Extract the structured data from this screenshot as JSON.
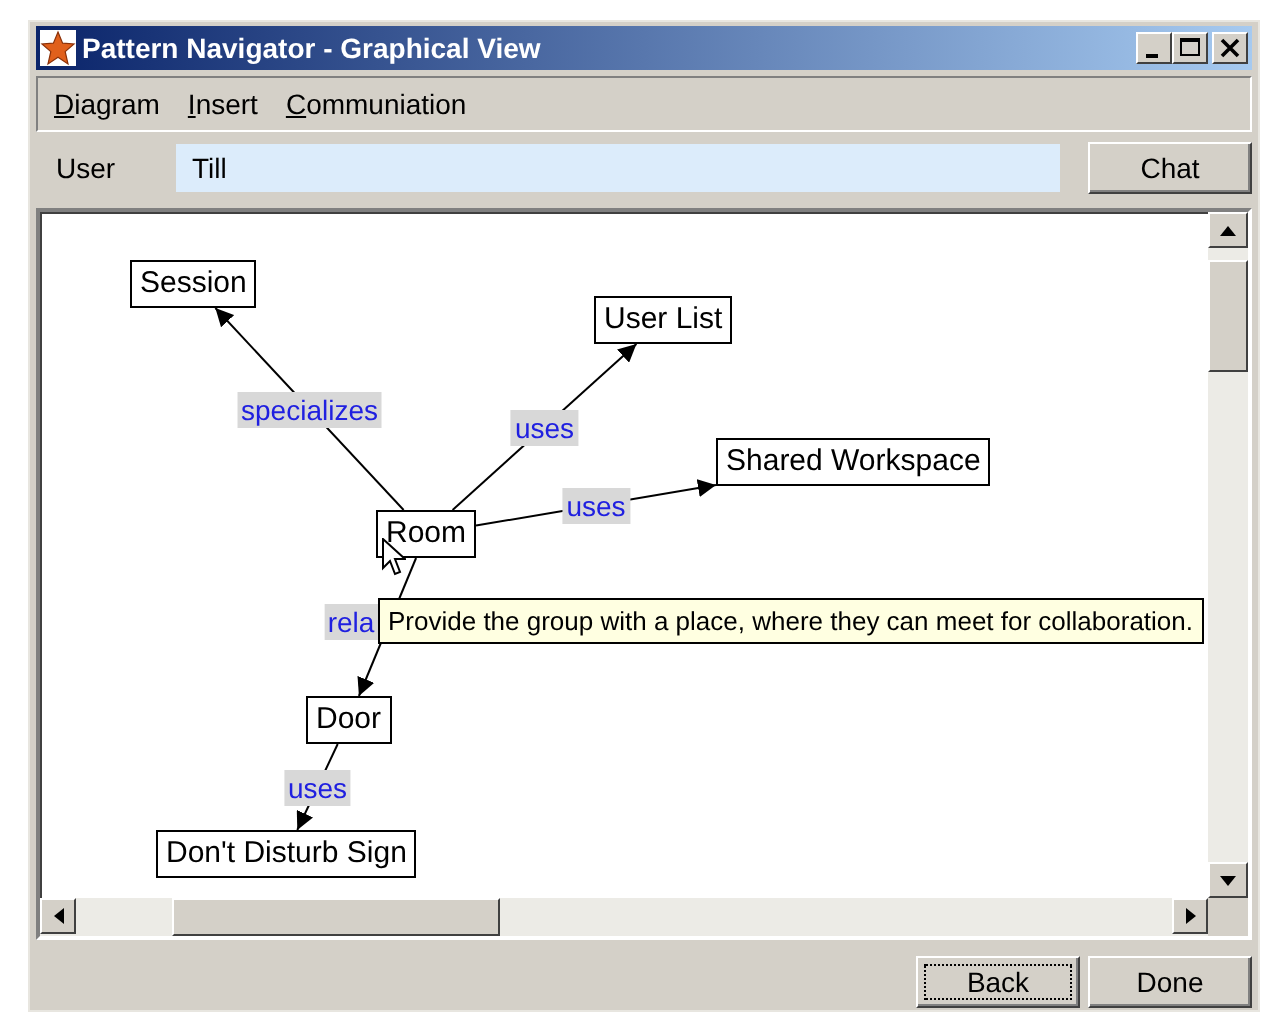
{
  "window": {
    "title": "Pattern Navigator - Graphical View"
  },
  "menu": [
    {
      "label": "Diagram"
    },
    {
      "label": "Insert"
    },
    {
      "label": "Communiation"
    }
  ],
  "user": {
    "label": "User",
    "value": "Till"
  },
  "chat_button": "Chat",
  "diagram": {
    "nodes": [
      {
        "label": "Room",
        "children": [
          {
            "label": "Session",
            "relation": "specializes"
          },
          {
            "label": "User List",
            "relation": "uses"
          },
          {
            "label": "Shared Workspace",
            "relation": "uses"
          },
          {
            "label": "Door",
            "relation": "rela",
            "children": [
              {
                "label": "Don't Disturb Sign",
                "relation": "uses"
              }
            ]
          }
        ]
      }
    ],
    "tooltip": "Provide the group with a place, where they can meet for collaboration."
  },
  "buttons": [
    {
      "label": "Back",
      "focused": true
    },
    {
      "label": "Done",
      "focused": false
    }
  ]
}
